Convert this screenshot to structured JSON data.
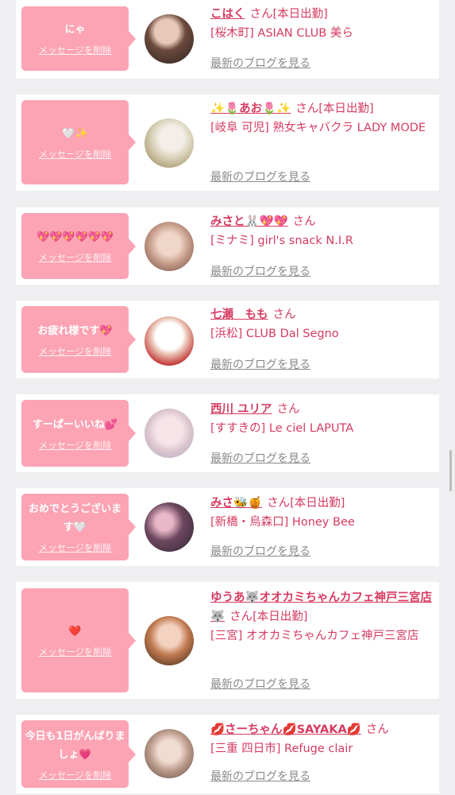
{
  "delete_label": "メッセージを削除",
  "blog_label": "最新のブログを見る",
  "san_label": "さん",
  "items": [
    {
      "msg": "にゃ",
      "name": "こはく",
      "suffix": "[本日出勤]",
      "shop": "[桜木町] ASIAN CLUB 美ら"
    },
    {
      "msg": "🤍✨",
      "name": "✨🌷あお🌷✨",
      "suffix": "[本日出勤]",
      "shop": "[岐阜 可児] 熟女キャバクラ LADY MODE"
    },
    {
      "msg": "💖💖💖💖💖💖",
      "name": "みさと🐰💖💖",
      "suffix": "",
      "shop": "[ミナミ] girl's snack N.I.R"
    },
    {
      "msg": "お疲れ様です💖",
      "name": "七瀬　もも",
      "suffix": "",
      "shop": "[浜松] CLUB Dal Segno"
    },
    {
      "msg": "すーぱーいいね💕",
      "name": "西川 ユリア",
      "suffix": "",
      "shop": "[すすきの] Le ciel LAPUTA"
    },
    {
      "msg": "おめでとうございます🤍",
      "name": "みさ🐝🍯",
      "suffix": "[本日出勤]",
      "shop": "[新橋・烏森口] Honey Bee"
    },
    {
      "msg": "❤️",
      "name": "ゆうあ🐺オオカミちゃんカフェ神戸三宮店🐺",
      "suffix": "[本日出勤]",
      "shop": "[三宮] オオカミちゃんカフェ神戸三宮店"
    },
    {
      "msg": "今日も1日がんばりましょ💗",
      "name": "💋さーちゃん💋SAYAKA💋",
      "suffix": "",
      "shop": "[三重 四日市] Refuge clair"
    }
  ],
  "colors": {
    "accent": "#d63b61",
    "bubble": "#fca3b4",
    "background": "#efeef0"
  }
}
